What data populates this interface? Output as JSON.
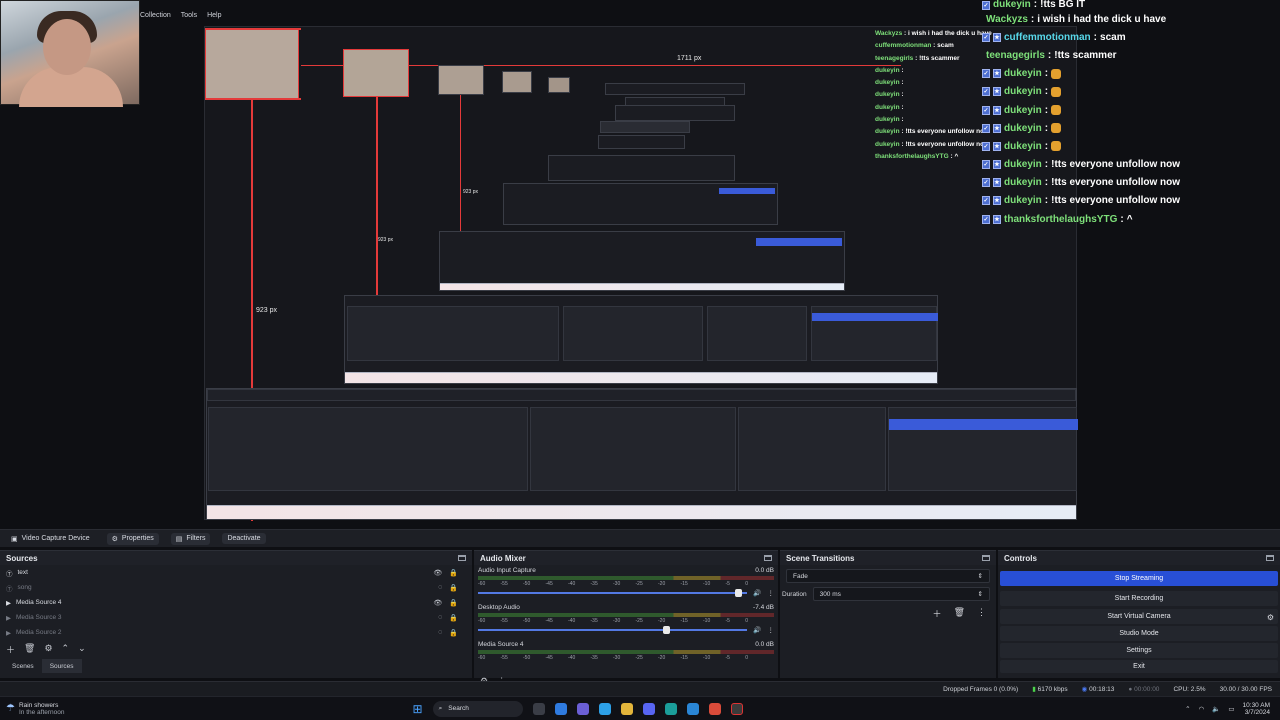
{
  "menu": {
    "items": [
      "Collection",
      "Tools",
      "Help"
    ]
  },
  "preview": {
    "px_label_1": "1711 px",
    "px_label_2": "923 px",
    "px_label_3": "923 px",
    "px_label_4": "923 px"
  },
  "chat": {
    "messages": [
      {
        "user": "dukeyin",
        "text": "!tts BG IT"
      },
      {
        "user": "Wackyzs",
        "text": "i wish i had the dick u have"
      },
      {
        "user": "cuffemmotionman",
        "text": "scam"
      },
      {
        "user": "teenagegirls",
        "text": "!tts scammer"
      },
      {
        "user": "dukeyin",
        "text": ""
      },
      {
        "user": "dukeyin",
        "text": ""
      },
      {
        "user": "dukeyin",
        "text": ""
      },
      {
        "user": "dukeyin",
        "text": ""
      },
      {
        "user": "dukeyin",
        "text": ""
      },
      {
        "user": "dukeyin",
        "text": "!tts everyone unfollow now"
      },
      {
        "user": "dukeyin",
        "text": "!tts everyone unfollow now"
      },
      {
        "user": "dukeyin",
        "text": "!tts everyone unfollow now"
      },
      {
        "user": "thanksforthelaughsYTG",
        "text": "^"
      }
    ]
  },
  "toolbar": {
    "source_name": "Video Capture Device",
    "properties": "Properties",
    "filters": "Filters",
    "deactivate": "Deactivate"
  },
  "sources": {
    "title": "Sources",
    "items": [
      {
        "label": "text",
        "dim": false
      },
      {
        "label": "song",
        "dim": true
      },
      {
        "label": "Media Source 4",
        "dim": false
      },
      {
        "label": "Media Source 3",
        "dim": true
      },
      {
        "label": "Media Source 2",
        "dim": true
      }
    ],
    "tab_scenes": "Scenes",
    "tab_sources": "Sources"
  },
  "mixer": {
    "title": "Audio Mixer",
    "scale": [
      "-60",
      "-55",
      "-50",
      "-45",
      "-40",
      "-35",
      "-30",
      "-25",
      "-20",
      "-15",
      "-10",
      "-5",
      "0"
    ],
    "channels": [
      {
        "name": "Audio Input Capture",
        "db": "0.0 dB",
        "level": 0.97
      },
      {
        "name": "Desktop Audio",
        "db": "-7.4 dB",
        "level": 0.7
      },
      {
        "name": "Media Source 4",
        "db": "0.0 dB",
        "level": 0.97
      }
    ]
  },
  "transitions": {
    "title": "Scene Transitions",
    "selected": "Fade",
    "duration_label": "Duration",
    "duration_value": "300 ms"
  },
  "controls": {
    "title": "Controls",
    "stop_streaming": "Stop Streaming",
    "start_recording": "Start Recording",
    "start_virtual_camera": "Start Virtual Camera",
    "studio_mode": "Studio Mode",
    "settings": "Settings",
    "exit": "Exit"
  },
  "status": {
    "dropped_frames": "Dropped Frames 0 (0.0%)",
    "bitrate": "6170 kbps",
    "stream_time": "00:18:13",
    "rec_time": "00:00:00",
    "cpu": "CPU: 2.5%",
    "fps": "30.00 / 30.00 FPS"
  },
  "taskbar": {
    "weather_title": "Rain showers",
    "weather_sub": "In the afternoon",
    "search": "Search",
    "time": "10:30 AM",
    "date": "3/7/2024"
  },
  "colors": {
    "accent": "#284fd6",
    "chat_name": "#7ee07a",
    "guide_red": "#e43a3a"
  }
}
